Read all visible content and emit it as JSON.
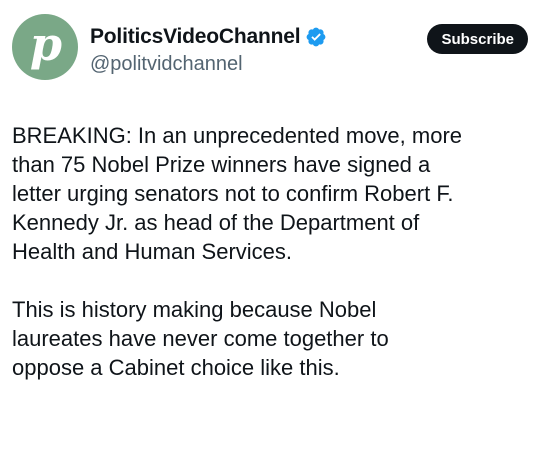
{
  "post": {
    "author": {
      "display_name": "PoliticsVideoChannel",
      "handle": "@politvidchannel",
      "avatar_letter": "p",
      "avatar_color": "#7aa887",
      "verified": true,
      "verified_color": "#1d9bf0"
    },
    "subscribe_label": "Subscribe",
    "paragraphs": [
      "BREAKING: In an unprecedented move, more\nthan 75 Nobel Prize winners have signed a\nletter urging senators not to confirm Robert F.\nKennedy Jr. as head of the Department of\nHealth and Human Services.",
      "This is history making because Nobel\nlaureates have never come together to\noppose a Cabinet choice like this."
    ]
  }
}
